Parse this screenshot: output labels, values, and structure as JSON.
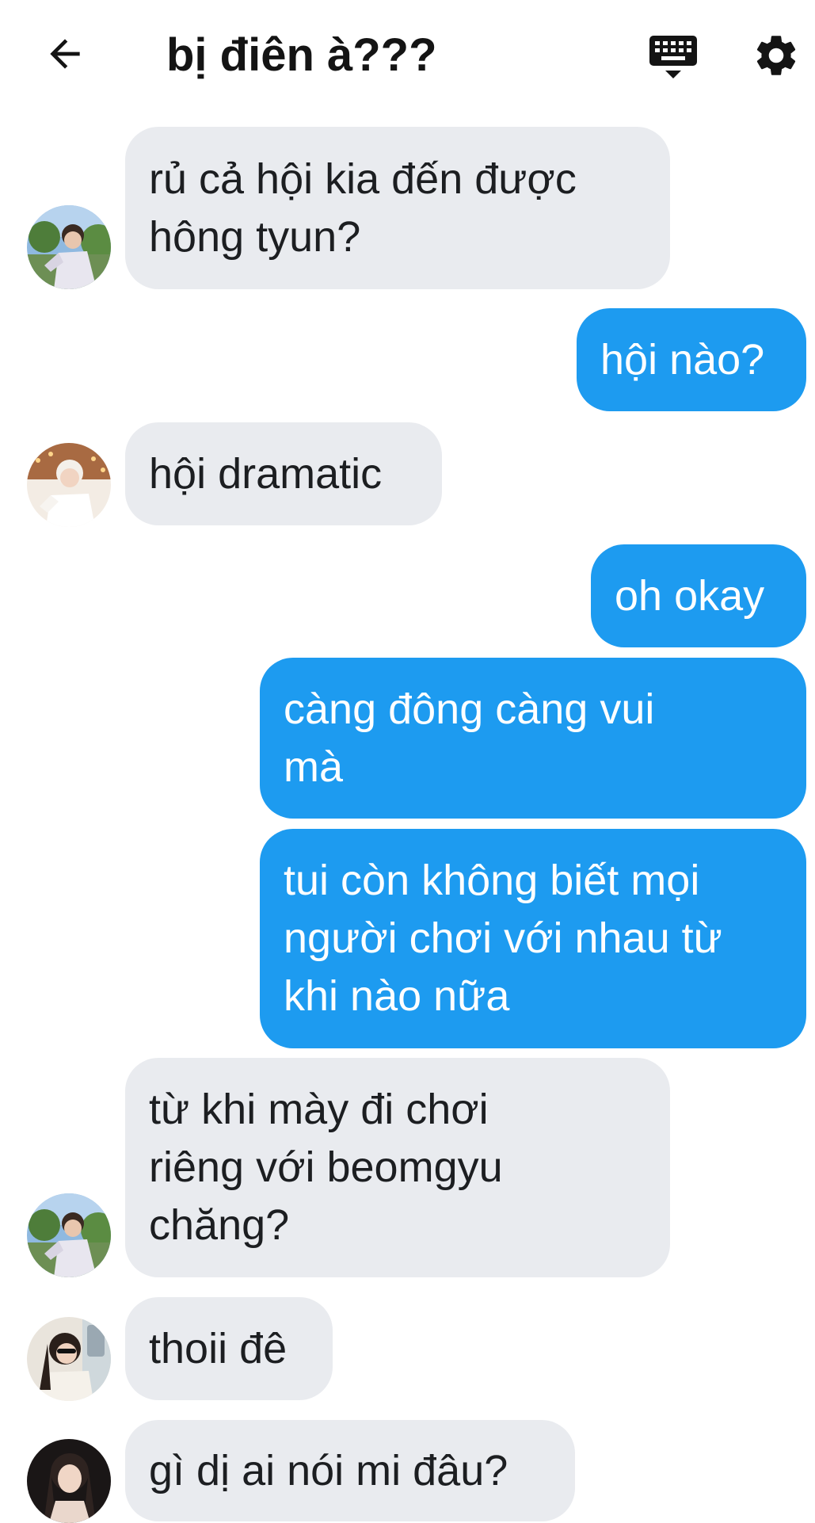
{
  "header": {
    "title": "bị điên à???",
    "back_icon": "arrow-left-icon",
    "keyboard_icon": "keyboard-icon",
    "settings_icon": "gear-icon"
  },
  "colors": {
    "outgoing_bubble": "#1d9bf0",
    "incoming_bubble": "#e9ebef",
    "text_dark": "#1c1e21",
    "text_light": "#ffffff"
  },
  "messages": [
    {
      "side": "in",
      "lines": [
        "rủ cả hội kia đến được",
        "hông tyun?"
      ],
      "avatar": "avatar-1"
    },
    {
      "side": "out",
      "lines": [
        "hội nào?"
      ]
    },
    {
      "side": "in",
      "lines": [
        "hội dramatic"
      ],
      "avatar": "avatar-2"
    },
    {
      "side": "out",
      "lines": [
        "oh okay"
      ]
    },
    {
      "side": "out",
      "lines": [
        "càng đông càng vui",
        "mà"
      ]
    },
    {
      "side": "out",
      "lines": [
        "tui còn không biết mọi",
        "người chơi với nhau từ",
        "khi nào nữa"
      ]
    },
    {
      "side": "in",
      "lines": [
        "từ khi mày đi chơi",
        "riêng với beomgyu",
        "chăng?"
      ],
      "avatar": "avatar-1"
    },
    {
      "side": "in",
      "lines": [
        "thoii đê"
      ],
      "avatar": "avatar-3"
    },
    {
      "side": "in",
      "lines": [
        "gì dị ai nói mi đâu?"
      ],
      "avatar": "avatar-4"
    }
  ]
}
